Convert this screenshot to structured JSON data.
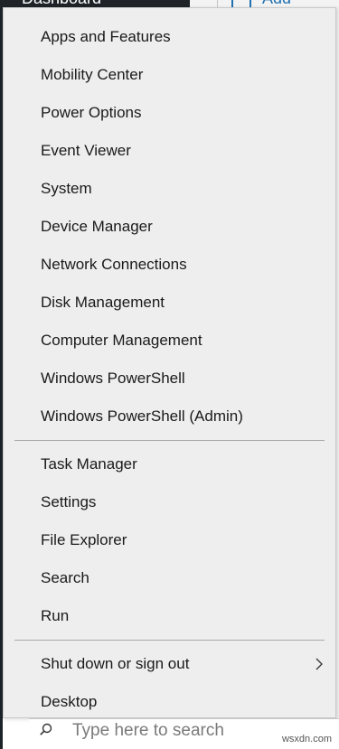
{
  "background": {
    "dashboard_label": "Dashboard",
    "add_media_label": "Add Media",
    "search_placeholder": "Type here to search",
    "watermark": "wsxdn.com"
  },
  "menu": {
    "group1": [
      {
        "label": "Apps and Features"
      },
      {
        "label": "Mobility Center"
      },
      {
        "label": "Power Options"
      },
      {
        "label": "Event Viewer"
      },
      {
        "label": "System"
      },
      {
        "label": "Device Manager"
      },
      {
        "label": "Network Connections"
      },
      {
        "label": "Disk Management"
      },
      {
        "label": "Computer Management"
      },
      {
        "label": "Windows PowerShell"
      },
      {
        "label": "Windows PowerShell (Admin)"
      }
    ],
    "group2": [
      {
        "label": "Task Manager"
      },
      {
        "label": "Settings"
      },
      {
        "label": "File Explorer"
      },
      {
        "label": "Search"
      },
      {
        "label": "Run"
      }
    ],
    "group3": [
      {
        "label": "Shut down or sign out",
        "submenu_icon": "chevron-right-icon"
      },
      {
        "label": "Desktop"
      }
    ]
  }
}
